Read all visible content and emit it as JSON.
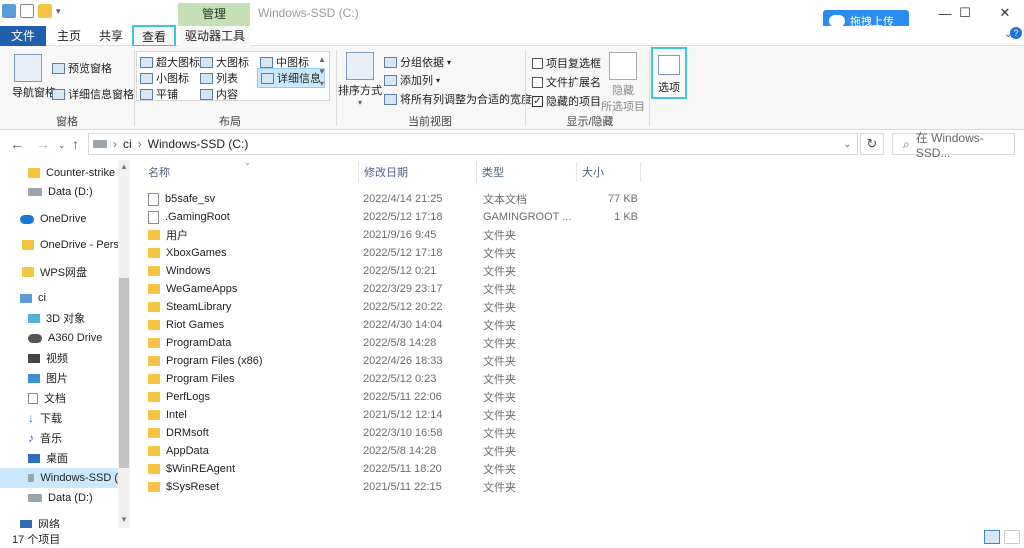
{
  "window": {
    "title": "Windows-SSD (C:)",
    "context_tab_group": "管理"
  },
  "upload_button": {
    "label": "拖拽上传"
  },
  "tabs": [
    {
      "label": "文件"
    },
    {
      "label": "主页"
    },
    {
      "label": "共享"
    },
    {
      "label": "查看",
      "selected": true
    },
    {
      "label": "驱动器工具"
    }
  ],
  "ribbon": {
    "pane": {
      "nav_pane": "导航窗格",
      "preview_pane": "预览窗格",
      "details_pane": "详细信息窗格",
      "group_label": "窗格"
    },
    "layout": {
      "items": [
        "超大图标",
        "大图标",
        "中图标",
        "小图标",
        "列表",
        "详细信息",
        "平铺",
        "内容"
      ],
      "selected": "详细信息",
      "group_label": "布局"
    },
    "current_view": {
      "sort_by": "排序方式",
      "group_by": "分组依据",
      "add_columns": "添加列",
      "size_all_columns": "将所有列调整为合适的宽度",
      "group_label": "当前视图"
    },
    "show_hide": {
      "item_checkboxes": {
        "label": "项目复选框",
        "checked": false
      },
      "file_extensions": {
        "label": "文件扩展名",
        "checked": false
      },
      "hidden_items": {
        "label": "隐藏的项目",
        "checked": true
      },
      "hide_selected_line1": "隐藏",
      "hide_selected_line2": "所选项目",
      "group_label": "显示/隐藏"
    },
    "options": {
      "label": "选项"
    }
  },
  "address": {
    "crumbs": [
      "ci",
      "Windows-SSD (C:)"
    ],
    "search_placeholder": "在 Windows-SSD..."
  },
  "nav_pane": [
    {
      "label": "Counter-strike",
      "icon": "folder-icon"
    },
    {
      "label": "Data (D:)",
      "icon": "drive-icon"
    },
    {
      "label": "OneDrive",
      "icon": "onedrive-icon"
    },
    {
      "label": "OneDrive - Perso",
      "icon": "folder-icon"
    },
    {
      "label": "WPS网盘",
      "icon": "folder-icon"
    },
    {
      "label": "ci",
      "icon": "computer-icon"
    },
    {
      "label": "3D 对象",
      "icon": "3d-objects-icon"
    },
    {
      "label": "A360 Drive",
      "icon": "a360-icon"
    },
    {
      "label": "视频",
      "icon": "video-icon"
    },
    {
      "label": "图片",
      "icon": "pictures-icon"
    },
    {
      "label": "文档",
      "icon": "documents-icon"
    },
    {
      "label": "下载",
      "icon": "downloads-icon"
    },
    {
      "label": "音乐",
      "icon": "music-icon"
    },
    {
      "label": "桌面",
      "icon": "desktop-icon"
    },
    {
      "label": "Windows-SSD (",
      "icon": "drive-icon",
      "selected": true
    },
    {
      "label": "Data (D:)",
      "icon": "drive-icon"
    },
    {
      "label": "网络",
      "icon": "network-icon"
    }
  ],
  "columns": {
    "name": "名称",
    "date": "修改日期",
    "type": "类型",
    "size": "大小"
  },
  "files": [
    {
      "name": "b5safe_sv",
      "date": "2022/4/14 21:25",
      "type": "文本文档",
      "size": "77 KB",
      "kind": "file"
    },
    {
      "name": ".GamingRoot",
      "date": "2022/5/12 17:18",
      "type": "GAMINGROOT ...",
      "size": "1 KB",
      "kind": "file"
    },
    {
      "name": "用户",
      "date": "2021/9/16 9:45",
      "type": "文件夹",
      "size": "",
      "kind": "folder"
    },
    {
      "name": "XboxGames",
      "date": "2022/5/12 17:18",
      "type": "文件夹",
      "size": "",
      "kind": "folder"
    },
    {
      "name": "Windows",
      "date": "2022/5/12 0:21",
      "type": "文件夹",
      "size": "",
      "kind": "folder"
    },
    {
      "name": "WeGameApps",
      "date": "2022/3/29 23:17",
      "type": "文件夹",
      "size": "",
      "kind": "folder"
    },
    {
      "name": "SteamLibrary",
      "date": "2022/5/12 20:22",
      "type": "文件夹",
      "size": "",
      "kind": "folder"
    },
    {
      "name": "Riot Games",
      "date": "2022/4/30 14:04",
      "type": "文件夹",
      "size": "",
      "kind": "folder"
    },
    {
      "name": "ProgramData",
      "date": "2022/5/8 14:28",
      "type": "文件夹",
      "size": "",
      "kind": "folder"
    },
    {
      "name": "Program Files (x86)",
      "date": "2022/4/26 18:33",
      "type": "文件夹",
      "size": "",
      "kind": "folder"
    },
    {
      "name": "Program Files",
      "date": "2022/5/12 0:23",
      "type": "文件夹",
      "size": "",
      "kind": "folder"
    },
    {
      "name": "PerfLogs",
      "date": "2022/5/11 22:06",
      "type": "文件夹",
      "size": "",
      "kind": "folder"
    },
    {
      "name": "Intel",
      "date": "2021/5/12 12:14",
      "type": "文件夹",
      "size": "",
      "kind": "folder"
    },
    {
      "name": "DRMsoft",
      "date": "2022/3/10 16:58",
      "type": "文件夹",
      "size": "",
      "kind": "folder"
    },
    {
      "name": "AppData",
      "date": "2022/5/8 14:28",
      "type": "文件夹",
      "size": "",
      "kind": "folder"
    },
    {
      "name": "$WinREAgent",
      "date": "2022/5/11 18:20",
      "type": "文件夹",
      "size": "",
      "kind": "folder"
    },
    {
      "name": "$SysReset",
      "date": "2021/5/11 22:15",
      "type": "文件夹",
      "size": "",
      "kind": "folder"
    }
  ],
  "status": {
    "item_count": "17 个项目"
  },
  "colors": {
    "accent": "#1f5fae",
    "highlight": "#3cc6d8",
    "context_tab": "#c5e0b4",
    "selection": "#cce8ff"
  }
}
